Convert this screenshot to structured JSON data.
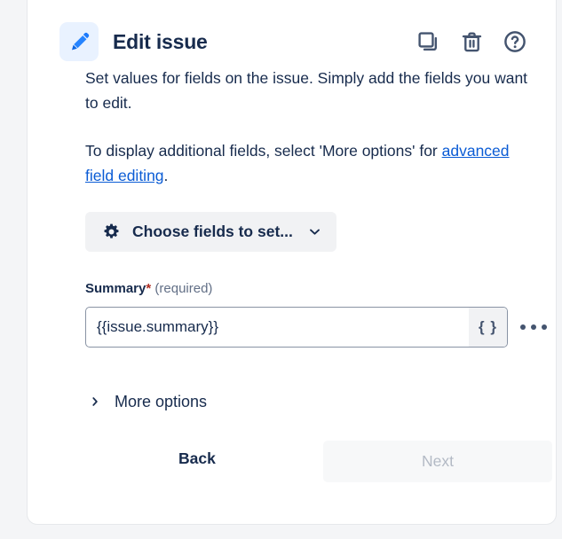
{
  "header": {
    "title": "Edit issue",
    "app_icon": "pencil-icon",
    "icon_bg": "#E9F2FF",
    "icon_color": "#1D7AFC",
    "actions": [
      {
        "name": "duplicate-icon",
        "label": "Duplicate"
      },
      {
        "name": "delete-icon",
        "label": "Delete"
      },
      {
        "name": "help-icon",
        "label": "Help"
      }
    ]
  },
  "body": {
    "paragraph_1": "Set values for fields on the issue. Simply add the fields you want to edit.",
    "paragraph_2_prefix": "To display additional fields, select 'More options' for ",
    "paragraph_2_link": "advanced field editing",
    "paragraph_2_suffix": "."
  },
  "choose_fields": {
    "label": "Choose fields to set...",
    "icon": "gear-icon",
    "chevron": "chevron-down-icon",
    "background": "#F1F2F4"
  },
  "summary_field": {
    "label": "Summary",
    "required_star": "*",
    "required_text": "(required)",
    "value": "{{issue.summary}}",
    "placeholder": "",
    "smart_values_button": "{ }",
    "more_menu": "ellipsis-icon",
    "required_star_color": "#AE2E24"
  },
  "more_options": {
    "label": "More options",
    "chevron": "chevron-right-icon",
    "expanded": false
  },
  "footer": {
    "back_label": "Back",
    "next_label": "Next",
    "next_disabled": true
  },
  "colors": {
    "page_background": "#F4F5F7",
    "card_background": "#FFFFFF",
    "text_primary": "#172B4D",
    "text_subtle": "#626F86",
    "link": "#0B5CD5",
    "accent_blue": "#1D7AFC",
    "disabled_text": "#B3BAC5"
  }
}
